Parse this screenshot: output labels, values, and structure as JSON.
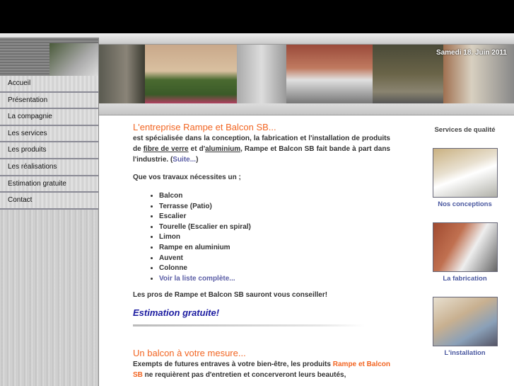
{
  "header": {
    "date": "Samedi 18. Juin 2011"
  },
  "menu": [
    "Accueil",
    "Présentation",
    "La compagnie",
    "Les services",
    "Les produits",
    "Les réalisations",
    "Estimation gratuite",
    "Contact"
  ],
  "main": {
    "title1": "L'entreprise Rampe et Balcon SB...",
    "p1a": "est spécialisée dans la conception, la fabrication et l'installation de produits de ",
    "p1_link1": "fibre de verre",
    "p1b": " et d'",
    "p1_link2": "aluminium",
    "p1c": ", Rampe et Balcon SB fait bande à part dans l'industrie. (",
    "p1_suite": "Suite...",
    "p1d": ")",
    "intro": "Que vos travaux nécessites un ;",
    "items": [
      "Balcon",
      "Terrasse (Patio)",
      "Escalier",
      "Tourelle (Escalier en spiral)",
      "Limon",
      "Rampe en aluminium",
      "Auvent",
      "Colonne"
    ],
    "full_list": "Voir la liste complète...",
    "pros": "Les pros de Rampe et Balcon SB sauront vous conseiller!",
    "estimate": "Estimation gratuite!",
    "title2": "Un balcon à votre mesure...",
    "p2a": "Exempts de futures entraves à votre bien-être, les produits ",
    "p2_brand": "Rampe et Balcon SB",
    "p2b": " ne requièrent pas d'entretien et concerveront leurs beautés,"
  },
  "right": {
    "title": "Services de qualité",
    "items": [
      "Nos conceptions",
      "La fabrication",
      "L'installation"
    ]
  }
}
